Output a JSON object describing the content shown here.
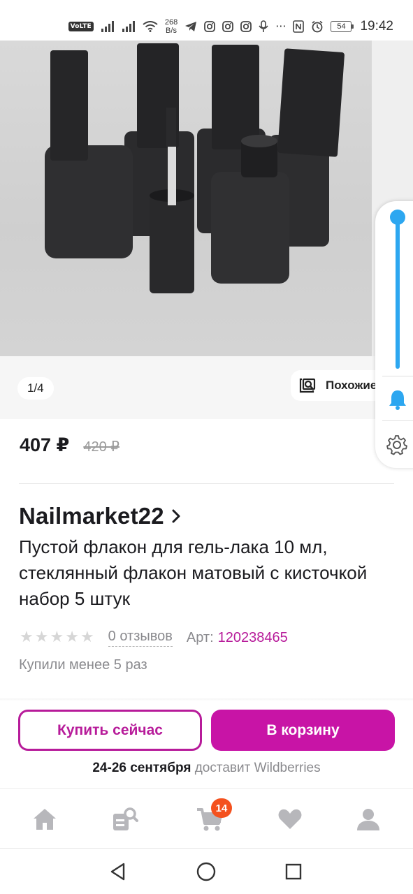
{
  "status_bar": {
    "volte": "VoLTE",
    "net_speed_value": "268",
    "net_speed_unit": "B/s",
    "battery": "54",
    "time": "19:42",
    "icons": [
      "volte-icon",
      "signal-icon",
      "signal-icon",
      "wifi-icon",
      "telegram-icon",
      "instagram-icon",
      "instagram-icon",
      "instagram-icon",
      "voice-icon",
      "more-icon",
      "nfc-icon",
      "alarm-icon",
      "battery-icon"
    ]
  },
  "gallery": {
    "counter": "1/4",
    "similar_label": "Похожие"
  },
  "side_panel": {
    "slider_level": 1.0,
    "icons": [
      "bell-icon",
      "gear-icon"
    ]
  },
  "price": {
    "current": "407 ₽",
    "old": "420 ₽"
  },
  "product": {
    "brand": "Nailmarket22",
    "title": "Пустой флакон для гель-лака 10 мл, стеклянный флакон матовый с кисточкой набор 5 штук",
    "rating_stars": 0,
    "reviews": "0 отзывов",
    "article_label": "Арт:",
    "article_value": "120238465",
    "bought": "Купили менее 5 раз"
  },
  "actions": {
    "buy_now": "Купить сейчас",
    "add_to_cart": "В корзину",
    "delivery_date": "24-26 сентября",
    "delivery_text": "доставит Wildberries"
  },
  "bottom_nav": {
    "items": [
      "home-icon",
      "catalog-search-icon",
      "cart-icon",
      "favorites-icon",
      "profile-icon"
    ],
    "cart_badge": "14"
  },
  "colors": {
    "accent": "#c814a6",
    "accent_text": "#b71b9a",
    "badge": "#f4511e",
    "slider": "#2da7f0"
  }
}
